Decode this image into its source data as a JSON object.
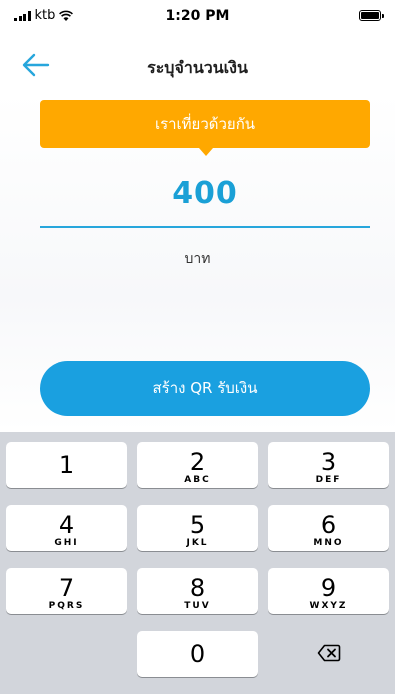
{
  "status_bar": {
    "carrier": "ktb",
    "time": "1:20 PM"
  },
  "nav": {
    "title": "ระบุจำนวนเงิน"
  },
  "tooltip": {
    "text": "เราเที่ยวด้วยกัน"
  },
  "amount": {
    "value": "400",
    "currency": "บาท"
  },
  "actions": {
    "create_qr": "สร้าง QR รับเงิน"
  },
  "keypad": {
    "keys": [
      {
        "num": "1",
        "letters": ""
      },
      {
        "num": "2",
        "letters": "ABC"
      },
      {
        "num": "3",
        "letters": "DEF"
      },
      {
        "num": "4",
        "letters": "GHI"
      },
      {
        "num": "5",
        "letters": "JKL"
      },
      {
        "num": "6",
        "letters": "MNO"
      },
      {
        "num": "7",
        "letters": "PQRS"
      },
      {
        "num": "8",
        "letters": "TUV"
      },
      {
        "num": "9",
        "letters": "WXYZ"
      },
      {
        "num": "0",
        "letters": ""
      }
    ]
  },
  "colors": {
    "accent": "#1aa0e0",
    "tooltip": "#ffa800",
    "keypad_bg": "#d2d5db"
  }
}
